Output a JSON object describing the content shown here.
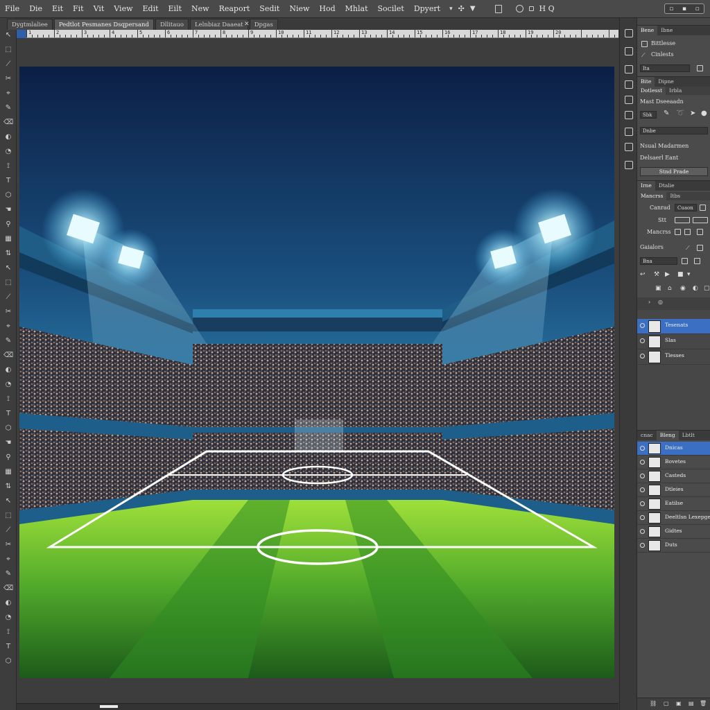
{
  "menubar": {
    "items": [
      "File",
      "Die",
      "Eit",
      "Fit",
      "Vit",
      "View",
      "Edit",
      "Eilt",
      "New",
      "Reaport",
      "Sedit",
      "Niew",
      "Hod",
      "Mhlat",
      "Socilet",
      "Dpyert"
    ],
    "right_text": "H Q"
  },
  "tabs": [
    "Dygtmlaliee",
    "Pedtlot Pesmanes Dsqpersand",
    "Dllitauo",
    "Lelnbiaz Daaeat",
    "Dpgas"
  ],
  "ruler_labels": [
    "1",
    "2",
    "3",
    "4",
    "5",
    "6",
    "7",
    "8",
    "9",
    "10",
    "11",
    "12",
    "13",
    "14",
    "15",
    "16",
    "17",
    "18",
    "19",
    "20"
  ],
  "panel_props": {
    "tabs": [
      "Bene",
      "Ibne"
    ],
    "row1": "Bittlesse",
    "row2": "Cinlests",
    "field": "Ita"
  },
  "panel_adjust": {
    "tabs": [
      "Bite",
      "Dipne"
    ],
    "subtabs": [
      "Dotlesst",
      "Irbla"
    ],
    "row1": "Mast Dseeaadn",
    "field1": "Sbk",
    "field2": "Dnbe",
    "row2": "Nsual Madarmen",
    "row3": "Delsaerl Eant",
    "button": "Stnd Prade"
  },
  "panel_char": {
    "tabs": [
      "Irne",
      "Dtalie"
    ],
    "subtabs": [
      "Mancrss",
      "Itbs"
    ],
    "row1": "Canrad",
    "row1_field": "Cuaon",
    "row2": "Stt",
    "row3": "Mancrss",
    "row4": "Gaialors",
    "field": "Bna"
  },
  "layers_top": [
    {
      "name": "Tesenats",
      "selected": true
    },
    {
      "name": "Slas",
      "selected": false
    },
    {
      "name": "Tlesses",
      "selected": false
    }
  ],
  "layers_bottom": {
    "tabs": [
      "cnac",
      "Bleng",
      "Lbtlt"
    ],
    "items": [
      {
        "name": "Dnicas",
        "selected": true
      },
      {
        "name": "Bovetes",
        "selected": false
      },
      {
        "name": "Casteds",
        "selected": false
      },
      {
        "name": "Dtleies",
        "selected": false
      },
      {
        "name": "Eatilse",
        "selected": false
      },
      {
        "name": "Deeltlsn Lexepget",
        "selected": false
      },
      {
        "name": "Gidtes",
        "selected": false
      },
      {
        "name": "Duts",
        "selected": false
      }
    ]
  },
  "colors": {
    "accent": "#3a6fc4",
    "panel": "#4b4b4b",
    "bg": "#3a3a3a"
  }
}
